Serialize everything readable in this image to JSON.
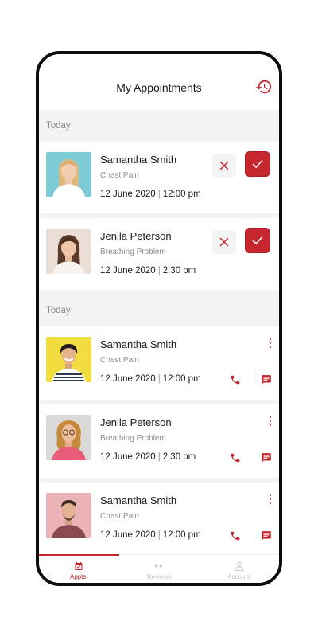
{
  "app": {
    "title": "My Appointments",
    "accent_color": "#c6262d",
    "history_icon": "history-icon"
  },
  "requests": {
    "section_label": "Today",
    "items": [
      {
        "name": "Samantha Smith",
        "reason": "Chest Pain",
        "date": "12 June 2020",
        "time": "12:00 pm",
        "avatar": "avatar-1"
      },
      {
        "name": "Jenila Peterson",
        "reason": "Breathing Problem",
        "date": "12 June 2020",
        "time": "2:30 pm",
        "avatar": "avatar-2"
      }
    ]
  },
  "appointments": {
    "section_label": "Today",
    "items": [
      {
        "name": "Samantha Smith",
        "reason": "Chest Pain",
        "date": "12 June 2020",
        "time": "12:00 pm",
        "avatar": "avatar-3"
      },
      {
        "name": "Jenila Peterson",
        "reason": "Breathing Problem",
        "date": "12 June 2020",
        "time": "2:30 pm",
        "avatar": "avatar-4"
      },
      {
        "name": "Samantha Smith",
        "reason": "Chest Pain",
        "date": "12 June 2020",
        "time": "12:00 pm",
        "avatar": "avatar-5"
      }
    ]
  },
  "tabs": [
    {
      "label": "Appts.",
      "icon": "calendar-icon",
      "active": true
    },
    {
      "label": "Reviews",
      "icon": "reviews-icon",
      "active": false
    },
    {
      "label": "Account",
      "icon": "account-icon",
      "active": false
    }
  ]
}
